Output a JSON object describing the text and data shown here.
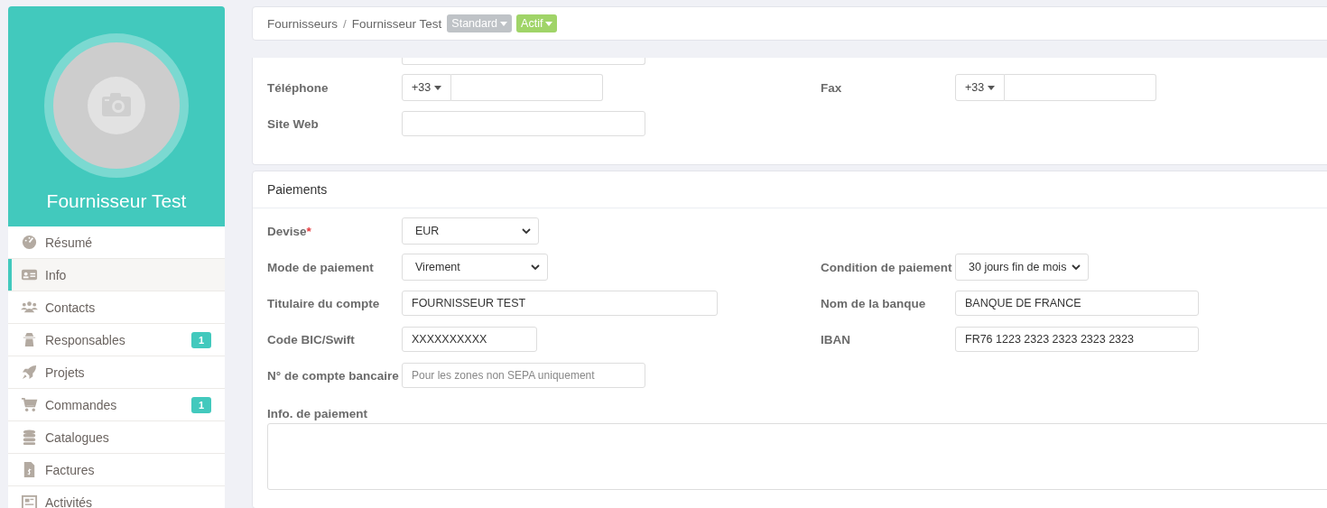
{
  "profile": {
    "name": "Fournisseur Test"
  },
  "sidebar": {
    "items": [
      {
        "label": "Résumé",
        "selected": false
      },
      {
        "label": "Info",
        "selected": true
      },
      {
        "label": "Contacts",
        "selected": false
      },
      {
        "label": "Responsables",
        "selected": false,
        "badge": "1"
      },
      {
        "label": "Projets",
        "selected": false
      },
      {
        "label": "Commandes",
        "selected": false,
        "badge": "1"
      },
      {
        "label": "Catalogues",
        "selected": false
      },
      {
        "label": "Factures",
        "selected": false
      },
      {
        "label": "Activités",
        "selected": false
      }
    ]
  },
  "breadcrumb": {
    "items": [
      "Fournisseurs"
    ],
    "separator": "/",
    "current": "Fournisseur Test",
    "tags": [
      {
        "label": "Standard",
        "color": "#bfc3c7"
      },
      {
        "label": "Actif",
        "color": "#a0d468"
      }
    ]
  },
  "contact_section": {
    "rows": [
      [
        {
          "label": "Téléphone",
          "kind": "phone",
          "prefix": "+33"
        },
        {
          "label": "Fax",
          "kind": "phone",
          "prefix": "+33"
        }
      ],
      [
        {
          "label": "Site Web",
          "kind": "text"
        }
      ]
    ]
  },
  "payments": {
    "title": "Paiements",
    "rows": [
      [
        {
          "label": "Devise",
          "kind": "select",
          "required_mark": "*",
          "value": "EUR"
        }
      ],
      [
        {
          "label": "Mode de paiement",
          "kind": "select",
          "value": "Virement"
        },
        {
          "label": "Condition de paiement",
          "kind": "select",
          "value": "30 jours fin de mois"
        }
      ],
      [
        {
          "label": "Titulaire du compte",
          "kind": "text",
          "value": "FOURNISSEUR TEST"
        },
        {
          "label": "Nom de la banque",
          "kind": "text",
          "value": "BANQUE DE FRANCE"
        }
      ],
      [
        {
          "label": "Code BIC/Swift",
          "kind": "text",
          "value": "XXXXXXXXXX"
        },
        {
          "label": "IBAN",
          "kind": "text",
          "value": "FR76 1223 2323 2323 2323 2323"
        }
      ],
      [
        {
          "label": "N° de compte bancaire",
          "kind": "text",
          "placeholder": "Pour les zones non SEPA uniquement"
        }
      ]
    ],
    "info_label": "Info. de paiement"
  }
}
